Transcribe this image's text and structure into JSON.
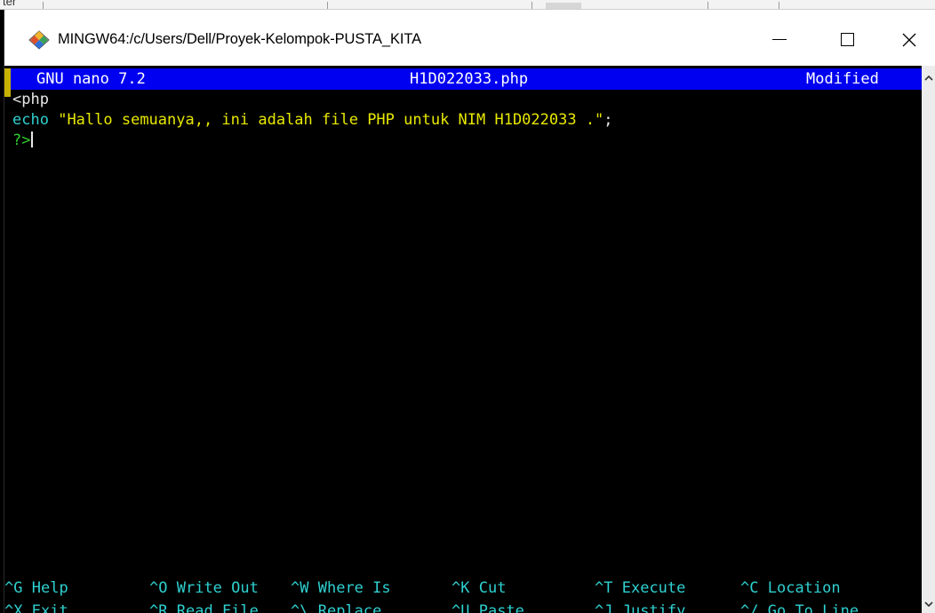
{
  "background_window": {
    "partial_text": "ter"
  },
  "window": {
    "title": "MINGW64:/c/Users/Dell/Proyek-Kelompok-PUSTA_KITA",
    "controls": {
      "minimize": "—",
      "maximize": "☐",
      "close": "✕"
    }
  },
  "nano": {
    "version": "GNU nano 7.2",
    "filename": "H1D022033.php",
    "state": "Modified"
  },
  "editor": {
    "line1": "<php",
    "line2_keyword": "echo",
    "line2_string": "\"Hallo semuanya,, ini adalah file PHP untuk NIM H1D022033 .\"",
    "line2_end": ";",
    "line3": "?>"
  },
  "shortcuts": {
    "row1": [
      {
        "key": "^G",
        "label": "Help"
      },
      {
        "key": "^O",
        "label": "Write Out"
      },
      {
        "key": "^W",
        "label": "Where Is"
      },
      {
        "key": "^K",
        "label": "Cut"
      },
      {
        "key": "^T",
        "label": "Execute"
      },
      {
        "key": "^C",
        "label": "Location"
      }
    ],
    "row2": [
      {
        "key": "^X",
        "label": "Exit"
      },
      {
        "key": "^R",
        "label": "Read File"
      },
      {
        "key": "^\\",
        "label": "Replace"
      },
      {
        "key": "^U",
        "label": "Paste"
      },
      {
        "key": "^J",
        "label": "Justify"
      },
      {
        "key": "^/",
        "label": "Go To Line"
      }
    ]
  },
  "colors": {
    "status_bar": "#0000f0",
    "keyword": "#2fd0d0",
    "string": "#e8e800",
    "php_close": "#2fd02f"
  },
  "icons": {
    "app": "git-bash-icon",
    "scroll_up": "chevron-up-icon",
    "scroll_down": "chevron-down-icon"
  }
}
